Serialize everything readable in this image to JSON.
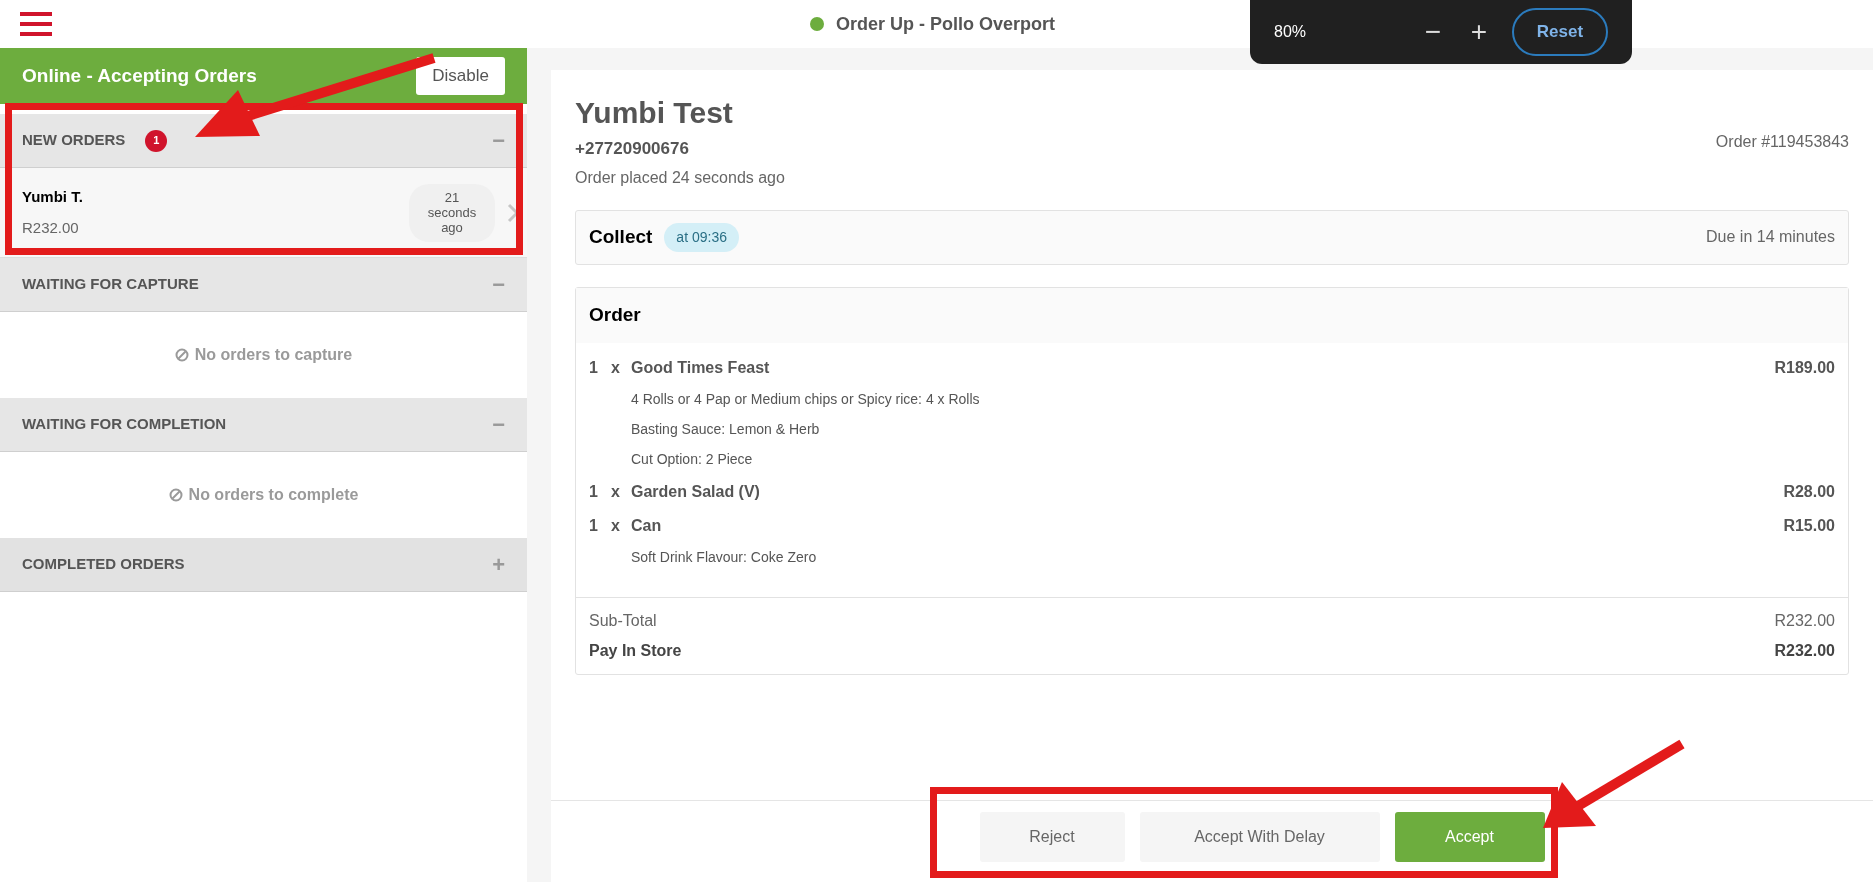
{
  "top_bar": {
    "title": "Order Up - Pollo Overport",
    "online": true
  },
  "zoom_popup": {
    "value": "80%",
    "minus": "−",
    "plus": "+",
    "reset": "Reset"
  },
  "status_banner": {
    "label": "Online - Accepting Orders",
    "button": "Disable"
  },
  "sections": [
    {
      "title": "NEW ORDERS",
      "badge": "1",
      "expanded": true,
      "toggle": "−",
      "orders": [
        {
          "name": "Yumbi T.",
          "amount": "R232.00",
          "age_number": "21",
          "age_unit": "seconds",
          "age_suffix": "ago"
        }
      ]
    },
    {
      "title": "WAITING FOR CAPTURE",
      "expanded": true,
      "toggle": "−",
      "empty": "No orders to capture"
    },
    {
      "title": "WAITING FOR COMPLETION",
      "expanded": true,
      "toggle": "−",
      "empty": "No orders to complete"
    },
    {
      "title": "COMPLETED ORDERS",
      "expanded": false,
      "toggle": "+"
    }
  ],
  "order": {
    "customer": "Yumbi Test",
    "phone": "+27720900676",
    "placed": "Order placed 24 seconds ago",
    "number": "Order #119453843",
    "fulfilment": {
      "type": "Collect",
      "time": "at 09:36",
      "due": "Due in 14 minutes"
    },
    "items_title": "Order",
    "items": [
      {
        "qty": "1",
        "x": "x",
        "name": "Good Times Feast",
        "price": "R189.00",
        "options": [
          "4 Rolls or 4 Pap or Medium chips or Spicy rice: 4 x Rolls",
          "Basting Sauce: Lemon & Herb",
          "Cut Option: 2 Piece"
        ]
      },
      {
        "qty": "1",
        "x": "x",
        "name": "Garden Salad (V)",
        "price": "R28.00"
      },
      {
        "qty": "1",
        "x": "x",
        "name": "Can",
        "price": "R15.00",
        "options": [
          "Soft Drink Flavour: Coke Zero"
        ]
      }
    ],
    "totals": [
      {
        "label": "Sub-Total",
        "value": "R232.00",
        "bold": false
      },
      {
        "label": "Pay In Store",
        "value": "R232.00",
        "bold": true
      }
    ]
  },
  "actions": [
    {
      "label": "Reject",
      "kind": "secondary"
    },
    {
      "label": "Accept With Delay",
      "kind": "secondary"
    },
    {
      "label": "Accept",
      "kind": "primary"
    }
  ]
}
